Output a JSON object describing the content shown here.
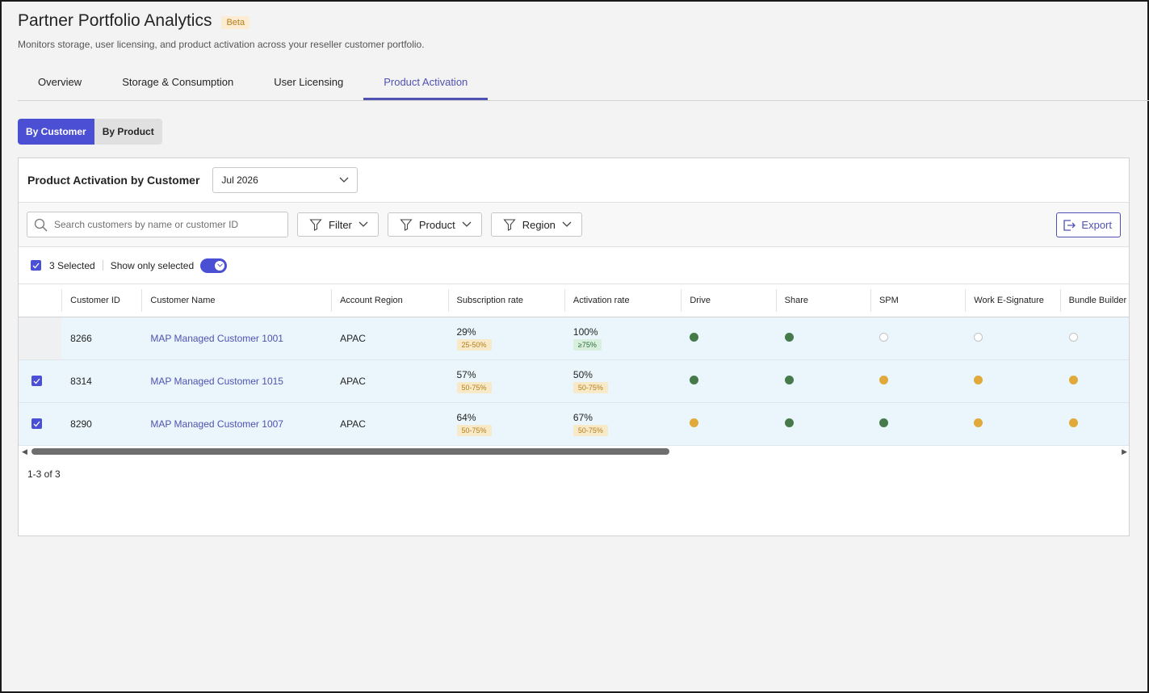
{
  "app": {
    "title": "Partner Portfolio Analytics",
    "badge": "Beta",
    "subtitle": "Monitors storage, user licensing, and product activation across your reseller customer portfolio."
  },
  "tabs": [
    "Overview",
    "Storage & Consumption",
    "User Licensing",
    "Product Activation"
  ],
  "active_tab": "Product Activation",
  "view_toggle": {
    "by_customer": "By Customer",
    "by_product": "By Product",
    "selected": "By Customer"
  },
  "card": {
    "title": "Product Activation by Customer",
    "month": "Jul 2026"
  },
  "toolbar": {
    "search_placeholder": "Search customers by name or customer ID",
    "filter_label": "Filter",
    "product_label": "Product",
    "region_label": "Region",
    "export_label": "Export"
  },
  "selection": {
    "count_label": "3 Selected",
    "show_only_label": "Show only selected",
    "show_only_on": true
  },
  "table": {
    "columns": [
      "Customer ID",
      "Customer Name",
      "Account Region",
      "Subscription rate",
      "Activation rate",
      "Drive",
      "Share",
      "SPM",
      "Work E-Signature",
      "Bundle Builder"
    ],
    "rows": [
      {
        "selected": false,
        "id": "8266",
        "name": "MAP Managed Customer 1001",
        "region": "APAC",
        "sub_rate": "29%",
        "sub_band": "25-50%",
        "act_rate": "100%",
        "act_band": "≥75%",
        "products": [
          "active",
          "active",
          "inactive",
          "inactive",
          "inactive"
        ]
      },
      {
        "selected": true,
        "id": "8314",
        "name": "MAP Managed Customer 1015",
        "region": "APAC",
        "sub_rate": "57%",
        "sub_band": "50-75%",
        "act_rate": "50%",
        "act_band": "50-75%",
        "products": [
          "active",
          "active",
          "partial",
          "partial",
          "partial"
        ]
      },
      {
        "selected": true,
        "id": "8290",
        "name": "MAP Managed Customer 1007",
        "region": "APAC",
        "sub_rate": "64%",
        "sub_band": "50-75%",
        "act_rate": "67%",
        "act_band": "50-75%",
        "products": [
          "partial",
          "active",
          "active",
          "partial",
          "partial"
        ]
      }
    ]
  },
  "pager": "1-3 of 3",
  "colors": {
    "accent": "#4b4fd3",
    "active": "#467a4a",
    "partial": "#e0a93a",
    "row_bg": "#eaf6fb"
  }
}
